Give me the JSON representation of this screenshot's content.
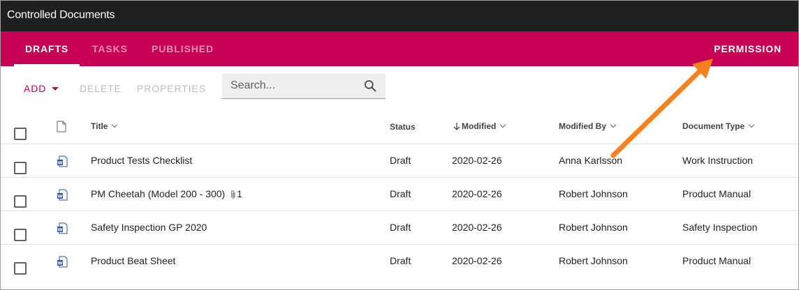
{
  "app": {
    "title": "Controlled Documents"
  },
  "tabs": [
    {
      "label": "DRAFTS",
      "active": true
    },
    {
      "label": "TASKS",
      "active": false
    },
    {
      "label": "PUBLISHED",
      "active": false
    }
  ],
  "permission_label": "PERMISSION",
  "toolbar": {
    "add_label": "ADD",
    "delete_label": "DELETE",
    "properties_label": "PROPERTIES",
    "search_placeholder": "Search...",
    "search_value": ""
  },
  "table": {
    "columns": {
      "title": "Title",
      "status": "Status",
      "modified": "Modified",
      "modified_by": "Modified By",
      "document_type": "Document Type"
    },
    "sort": {
      "column": "modified",
      "direction": "descending"
    },
    "rows": [
      {
        "title": "Product Tests Checklist",
        "attachments": "",
        "status": "Draft",
        "modified": "2020-02-26",
        "modified_by": "Anna Karlsson",
        "document_type": "Work Instruction"
      },
      {
        "title": "PM Cheetah (Model 200 - 300)",
        "attachments": "1",
        "status": "Draft",
        "modified": "2020-02-26",
        "modified_by": "Robert Johnson",
        "document_type": "Product Manual"
      },
      {
        "title": "Safety Inspection GP 2020",
        "attachments": "",
        "status": "Draft",
        "modified": "2020-02-26",
        "modified_by": "Robert Johnson",
        "document_type": "Safety Inspection"
      },
      {
        "title": "Product Beat Sheet",
        "attachments": "",
        "status": "Draft",
        "modified": "2020-02-26",
        "modified_by": "Robert Johnson",
        "document_type": "Product Manual"
      }
    ]
  },
  "colors": {
    "titlebar": "#1f1f1f",
    "accent": "#c80055",
    "annotation_arrow": "#f5821f",
    "word_icon": "#2b579a"
  },
  "icons": {
    "search": "search-icon",
    "document_header": "document-icon",
    "file": "word-document-icon",
    "attachment": "paperclip-icon",
    "sort": "arrow-down-icon"
  }
}
